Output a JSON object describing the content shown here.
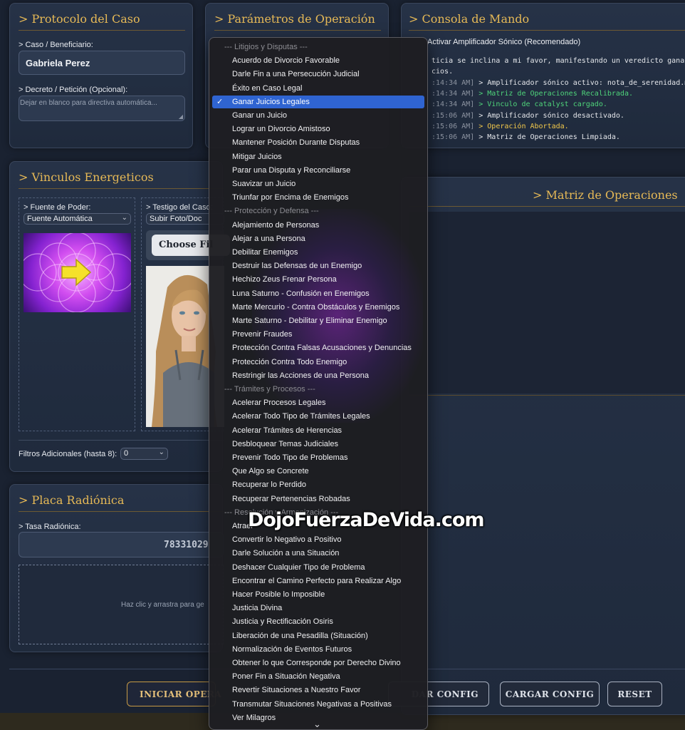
{
  "protocolo": {
    "title": "> Protocolo del Caso",
    "caso_label": "> Caso / Beneficiario:",
    "caso_value": "Gabriela Perez",
    "decreto_label": "> Decreto / Petición (Opcional):",
    "decreto_placeholder": "Dejar en blanco para directiva automática..."
  },
  "parametros": {
    "title": "> Parámetros de Operación"
  },
  "consola": {
    "title": "> Consola de Mando",
    "amplifier_label": "Activar Amplificador Sónico (Recomendado)",
    "lines": [
      {
        "text": "ticia se inclina a mi favor, manifestando un veredicto ganac",
        "color": "#e5e7eb"
      },
      {
        "text": "cios.",
        "color": "#e5e7eb"
      },
      {
        "ts": ":14:34 AM]",
        "msg": "> Amplificador sónico activo: nota_de_serenidad.m",
        "color": "#e5e7eb"
      },
      {
        "ts": ":14:34 AM]",
        "msg": "> Matriz de Operaciones Recalibrada.",
        "color": "#4fd47a"
      },
      {
        "ts": ":14:34 AM]",
        "msg": "> Vinculo de catalyst cargado.",
        "color": "#4fd47a"
      },
      {
        "ts": ":15:06 AM]",
        "msg": "> Amplificador sónico desactivado.",
        "color": "#e5e7eb"
      },
      {
        "ts": ":15:06 AM]",
        "msg": "> Operación Abortada.",
        "color": "#f1c84b"
      },
      {
        "ts": ":15:06 AM]",
        "msg": "> Matriz de Operaciones Limpiada.",
        "color": "#e5e7eb"
      }
    ]
  },
  "matriz": {
    "title": "> Matriz de Operaciones"
  },
  "vinculos": {
    "title": "> Vinculos Energeticos",
    "fuente_label": "> Fuente de Poder:",
    "fuente_value": "Fuente Automática",
    "testigo_label": "> Testigo del Caso:",
    "testigo_value": "Subir Foto/Doc",
    "choose_file": "Choose Fil",
    "filtros_label": "Filtros Adicionales (hasta 8):",
    "filtros_value": "0"
  },
  "placa": {
    "title": "> Placa Radiónica",
    "tasa_label": "> Tasa Radiónica:",
    "tasa_value": "78331029",
    "drop_text": "Haz clic y arrastra para ge"
  },
  "buttons": {
    "iniciar": "INICIAR OPERA",
    "guardar": "DAR CONFIG",
    "cargar": "CARGAR CONFIG",
    "reset": "RESET"
  },
  "dropdown": {
    "items": [
      {
        "label": "--- Litigios y Disputas ---",
        "group": true
      },
      {
        "label": "Acuerdo de Divorcio Favorable"
      },
      {
        "label": "Darle Fin a una Persecución Judicial"
      },
      {
        "label": "Éxito en Caso Legal"
      },
      {
        "label": "Ganar Juicios Legales",
        "selected": true
      },
      {
        "label": "Ganar un Juicio"
      },
      {
        "label": "Lograr un Divorcio Amistoso"
      },
      {
        "label": "Mantener Posición Durante Disputas"
      },
      {
        "label": "Mitigar Juicios"
      },
      {
        "label": "Parar una Disputa y Reconciliarse"
      },
      {
        "label": "Suavizar un Juicio"
      },
      {
        "label": "Triunfar por Encima de Enemigos"
      },
      {
        "label": "--- Protección y Defensa ---",
        "group": true
      },
      {
        "label": "Alejamiento de Personas"
      },
      {
        "label": "Alejar a una Persona"
      },
      {
        "label": "Debilitar Enemigos"
      },
      {
        "label": "Destruir las Defensas de un Enemigo"
      },
      {
        "label": "Hechizo Zeus Frenar Persona"
      },
      {
        "label": "Luna Saturno - Confusión en Enemigos"
      },
      {
        "label": "Marte Mercurio - Contra Obstáculos y Enemigos"
      },
      {
        "label": "Marte Saturno - Debilitar y Eliminar Enemigo"
      },
      {
        "label": "Prevenir Fraudes"
      },
      {
        "label": "Protección Contra Falsas Acusaciones y Denuncias"
      },
      {
        "label": "Protección Contra Todo Enemigo"
      },
      {
        "label": "Restringir las Acciones de una Persona"
      },
      {
        "label": "--- Trámites y Procesos ---",
        "group": true
      },
      {
        "label": "Acelerar Procesos Legales"
      },
      {
        "label": "Acelerar Todo Tipo de Trámites Legales"
      },
      {
        "label": "Acelerar Trámites de Herencias"
      },
      {
        "label": "Desbloquear Temas Judiciales"
      },
      {
        "label": "Prevenir Todo Tipo de Problemas"
      },
      {
        "label": "Que Algo se Concrete"
      },
      {
        "label": "Recuperar lo Perdido"
      },
      {
        "label": "Recuperar Pertenencias Robadas"
      },
      {
        "label": "--- Resolución y Armonización ---",
        "group": true
      },
      {
        "label": "Atraer"
      },
      {
        "label": "Convertir lo Negativo a Positivo"
      },
      {
        "label": "Darle Solución a una Situación"
      },
      {
        "label": "Deshacer Cualquier Tipo de Problema"
      },
      {
        "label": "Encontrar el Camino Perfecto para Realizar Algo"
      },
      {
        "label": "Hacer Posible lo Imposible"
      },
      {
        "label": "Justicia Divina"
      },
      {
        "label": "Justicia y Rectificación Osiris"
      },
      {
        "label": "Liberación de una Pesadilla (Situación)"
      },
      {
        "label": "Normalización de Eventos Futuros"
      },
      {
        "label": "Obtener lo que Corresponde por Derecho Divino"
      },
      {
        "label": "Poner Fin a Situación Negativa"
      },
      {
        "label": "Revertir Situaciones a Nuestro Favor"
      },
      {
        "label": "Transmutar Situaciones Negativas a Positivas"
      },
      {
        "label": "Ver Milagros"
      }
    ]
  },
  "watermark": "DojoFuerzaDeVida.com"
}
